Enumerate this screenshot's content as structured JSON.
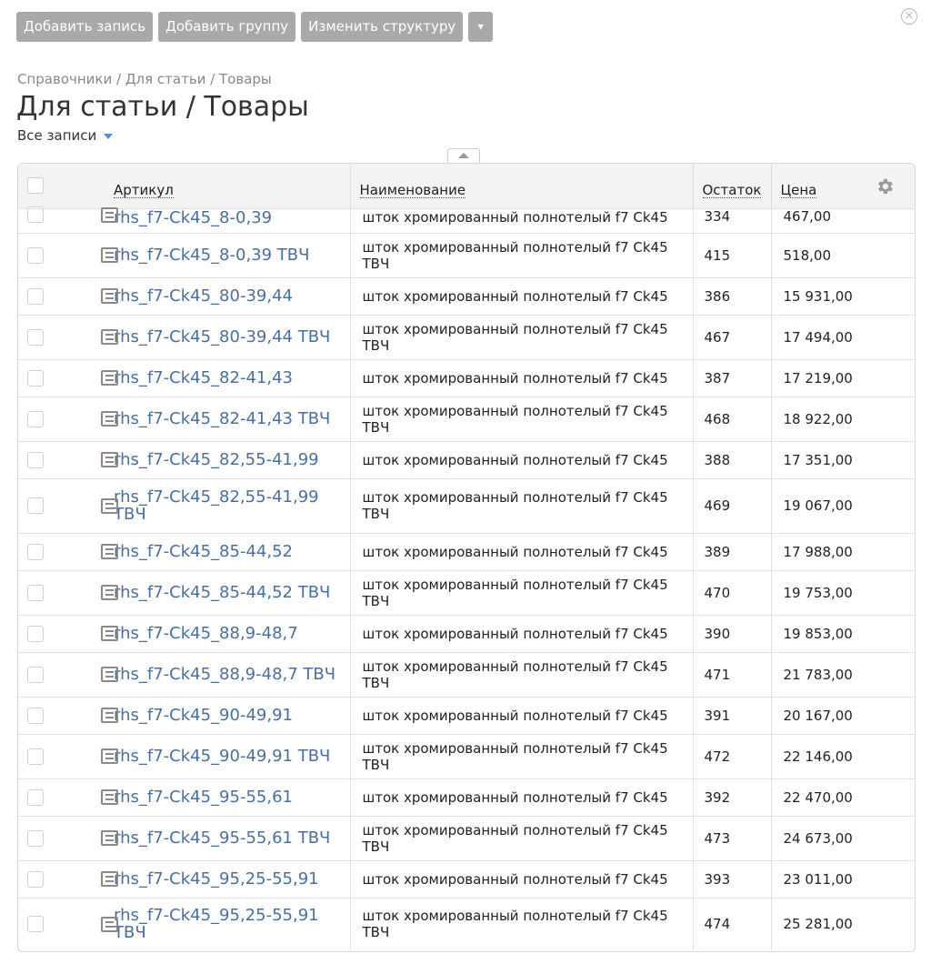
{
  "toolbar": {
    "add_record": "Добавить запись",
    "add_group": "Добавить группу",
    "change_structure": "Изменить структуру",
    "more": "▾"
  },
  "close_icon": "×",
  "breadcrumb": "Справочники / Для статьи / Товары",
  "title": "Для статьи / Товары",
  "filter": "Все записи",
  "columns": {
    "sku": "Артикул",
    "name": "Наименование",
    "stock": "Остаток",
    "price": "Цена"
  },
  "rows": [
    {
      "sku": "rhs_f7-Ck45_8-0,39",
      "name": "шток хромированный полнотелый f7 Ck45",
      "stock": "334",
      "price": "467,00"
    },
    {
      "sku": "rhs_f7-Ck45_8-0,39 ТВЧ",
      "name": "шток хромированный полнотелый f7 Ck45 ТВЧ",
      "stock": "415",
      "price": "518,00"
    },
    {
      "sku": "rhs_f7-Ck45_80-39,44",
      "name": "шток хромированный полнотелый f7 Ck45",
      "stock": "386",
      "price": "15 931,00"
    },
    {
      "sku": "rhs_f7-Ck45_80-39,44 ТВЧ",
      "name": "шток хромированный полнотелый f7 Ck45 ТВЧ",
      "stock": "467",
      "price": "17 494,00"
    },
    {
      "sku": "rhs_f7-Ck45_82-41,43",
      "name": "шток хромированный полнотелый f7 Ck45",
      "stock": "387",
      "price": "17 219,00"
    },
    {
      "sku": "rhs_f7-Ck45_82-41,43 ТВЧ",
      "name": "шток хромированный полнотелый f7 Ck45 ТВЧ",
      "stock": "468",
      "price": "18 922,00"
    },
    {
      "sku": "rhs_f7-Ck45_82,55-41,99",
      "name": "шток хромированный полнотелый f7 Ck45",
      "stock": "388",
      "price": "17 351,00"
    },
    {
      "sku": "rhs_f7-Ck45_82,55-41,99 ТВЧ",
      "name": "шток хромированный полнотелый f7 Ck45 ТВЧ",
      "stock": "469",
      "price": "19 067,00"
    },
    {
      "sku": "rhs_f7-Ck45_85-44,52",
      "name": "шток хромированный полнотелый f7 Ck45",
      "stock": "389",
      "price": "17 988,00"
    },
    {
      "sku": "rhs_f7-Ck45_85-44,52 ТВЧ",
      "name": "шток хромированный полнотелый f7 Ck45 ТВЧ",
      "stock": "470",
      "price": "19 753,00"
    },
    {
      "sku": "rhs_f7-Ck45_88,9-48,7",
      "name": "шток хромированный полнотелый f7 Ck45",
      "stock": "390",
      "price": "19 853,00"
    },
    {
      "sku": "rhs_f7-Ck45_88,9-48,7 ТВЧ",
      "name": "шток хромированный полнотелый f7 Ck45 ТВЧ",
      "stock": "471",
      "price": "21 783,00"
    },
    {
      "sku": "rhs_f7-Ck45_90-49,91",
      "name": "шток хромированный полнотелый f7 Ck45",
      "stock": "391",
      "price": "20 167,00"
    },
    {
      "sku": "rhs_f7-Ck45_90-49,91 ТВЧ",
      "name": "шток хромированный полнотелый f7 Ck45 ТВЧ",
      "stock": "472",
      "price": "22 146,00"
    },
    {
      "sku": "rhs_f7-Ck45_95-55,61",
      "name": "шток хромированный полнотелый f7 Ck45",
      "stock": "392",
      "price": "22 470,00"
    },
    {
      "sku": "rhs_f7-Ck45_95-55,61 ТВЧ",
      "name": "шток хромированный полнотелый f7 Ck45 ТВЧ",
      "stock": "473",
      "price": "24 673,00"
    },
    {
      "sku": "rhs_f7-Ck45_95,25-55,91",
      "name": "шток хромированный полнотелый f7 Ck45",
      "stock": "393",
      "price": "23 011,00"
    },
    {
      "sku": "rhs_f7-Ck45_95,25-55,91 ТВЧ",
      "name": "шток хромированный полнотелый f7 Ck45 ТВЧ",
      "stock": "474",
      "price": "25 281,00"
    }
  ],
  "icons": {
    "close": "close-icon",
    "settings": "gear-icon",
    "record": "document-icon",
    "collapse": "chevron-up-icon",
    "dropdown": "caret-down-icon"
  },
  "colors": {
    "toolbar_button": "#a9a9a9",
    "link": "#4a6f9e",
    "accent": "#4a90d9",
    "header_bg": "#f3f3f3"
  }
}
